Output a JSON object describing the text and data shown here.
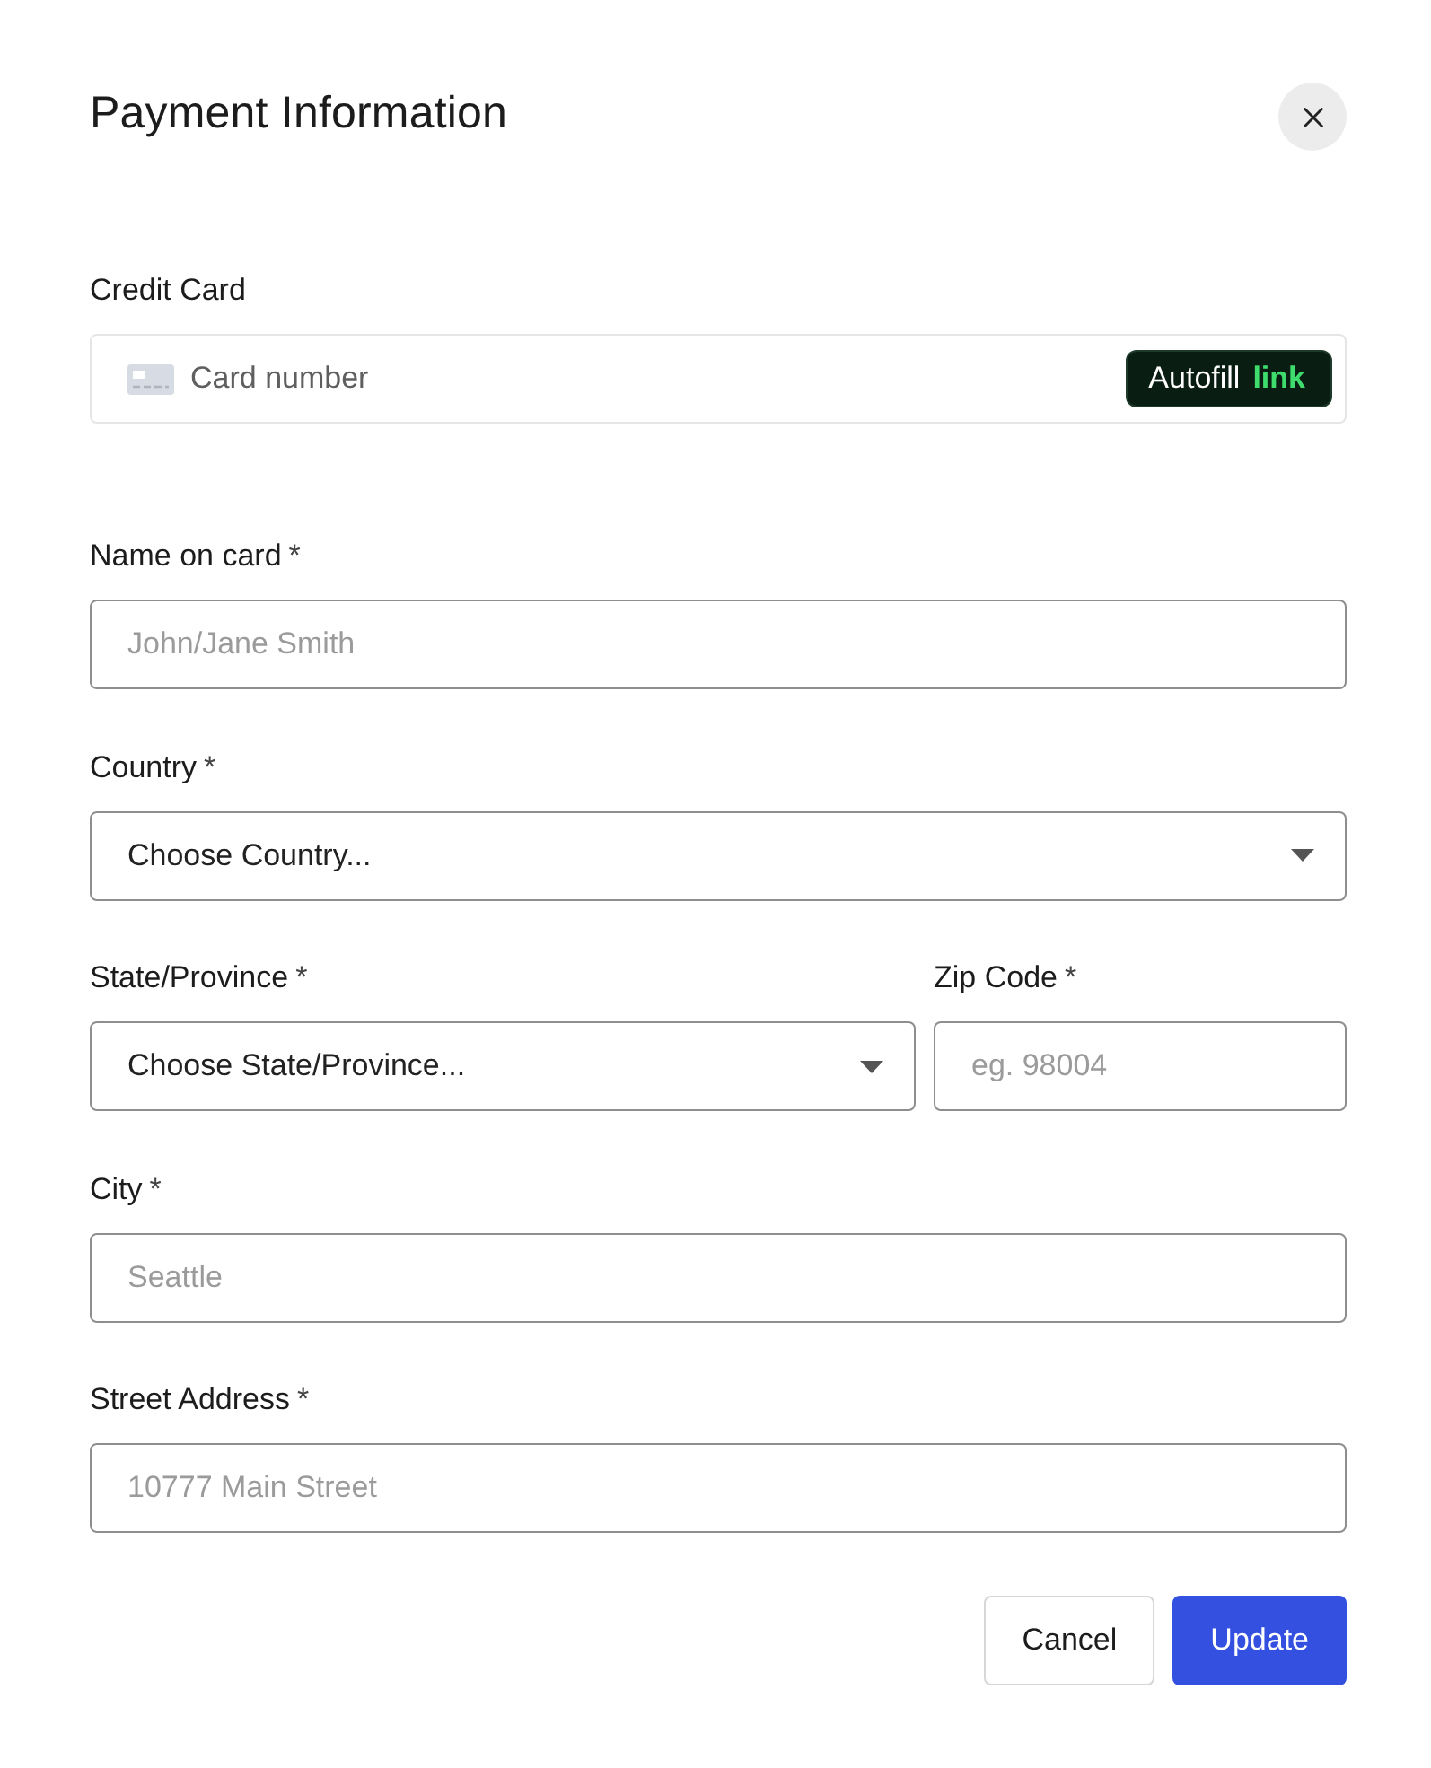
{
  "dialog": {
    "title": "Payment Information",
    "closable": true
  },
  "credit_card": {
    "label": "Credit Card",
    "placeholder": "Card number",
    "autofill_button": {
      "text": "Autofill",
      "brand": "link"
    }
  },
  "rows": [
    {
      "fields": [
        {
          "kind": "text",
          "label": "Name on card",
          "required_mark": "*",
          "placeholder": "John/Jane Smith"
        }
      ]
    },
    {
      "fields": [
        {
          "kind": "select",
          "label": "Country",
          "required_mark": "*",
          "value": "Choose Country..."
        }
      ]
    },
    {
      "fields": [
        {
          "kind": "select",
          "label": "State/Province",
          "required_mark": "*",
          "value": "Choose State/Province..."
        },
        {
          "kind": "text",
          "label": "Zip Code",
          "required_mark": "*",
          "placeholder": "eg. 98004"
        }
      ]
    },
    {
      "fields": [
        {
          "kind": "text",
          "label": "City",
          "required_mark": "*",
          "placeholder": "Seattle"
        }
      ]
    },
    {
      "fields": [
        {
          "kind": "text",
          "label": "Street Address",
          "required_mark": "*",
          "placeholder": "10777 Main Street"
        }
      ]
    }
  ],
  "buttons": [
    {
      "kind": "secondary",
      "label": "Cancel"
    },
    {
      "kind": "primary",
      "label": "Update"
    }
  ]
}
